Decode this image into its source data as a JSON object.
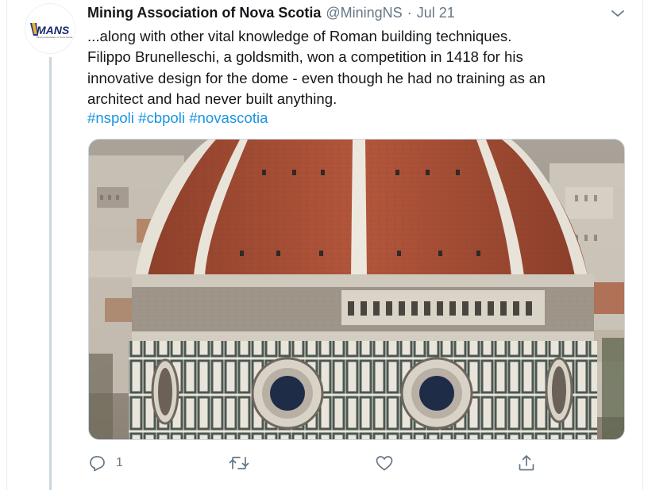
{
  "tweet": {
    "author_name": "Mining Association of Nova Scotia",
    "handle": "@MiningNS",
    "separator": "·",
    "date": "Jul 21",
    "avatar_text": "MANS",
    "avatar_subtext": "Mining Association of Nova Scotia",
    "text_lines": [
      "...along with other vital knowledge of Roman building techniques.",
      "Filippo Brunelleschi, a goldsmith, won a competition in 1418 for his",
      "innovative design for the dome - even though he had no training as an",
      "architect and had never built anything."
    ],
    "hashtags": [
      "#nspoli",
      "#cbpoli",
      "#novascotia"
    ],
    "actions": {
      "reply_count": "1",
      "retweet_count": "",
      "like_count": ""
    }
  },
  "colors": {
    "text": "#14171a",
    "secondary": "#657786",
    "link": "#1b95e0",
    "thread_line": "#ccd6dd"
  },
  "icons": {
    "more": "chevron-down-icon",
    "reply": "reply-icon",
    "retweet": "retweet-icon",
    "like": "heart-icon",
    "share": "share-icon"
  }
}
